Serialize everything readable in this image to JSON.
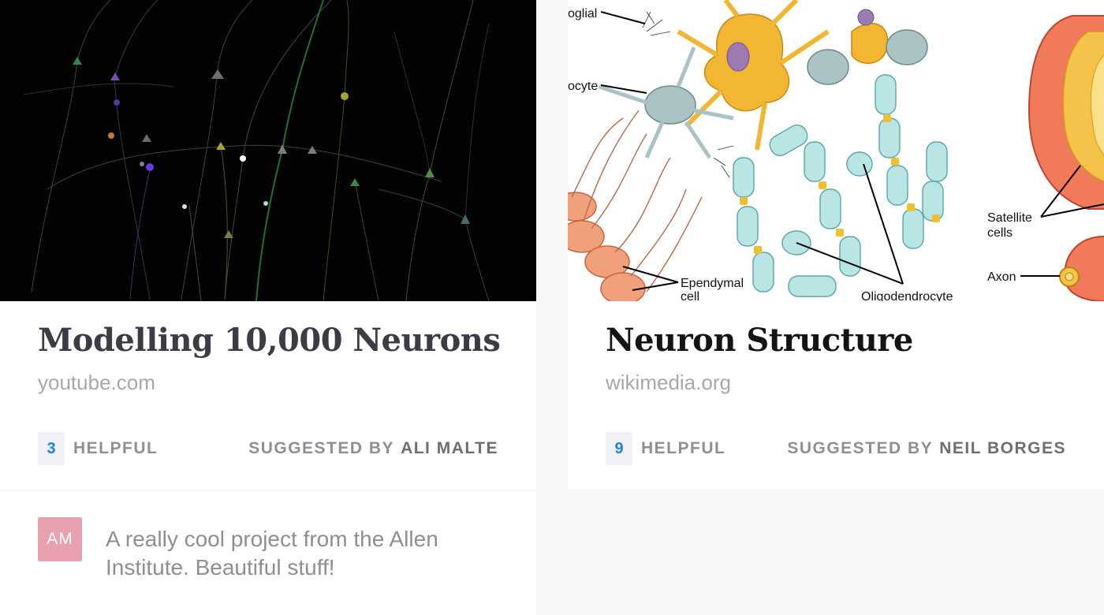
{
  "cards": [
    {
      "title": "Modelling 10,000 Neurons",
      "domain": "youtube.com",
      "helpful_count": "3",
      "helpful_label": "HELPFUL",
      "suggested_label": "SUGGESTED BY",
      "author": "ALI MALTE",
      "image": "neuron-simulation-render"
    },
    {
      "title": "Neuron Structure",
      "domain": "wikimedia.org",
      "helpful_count": "9",
      "helpful_label": "HELPFUL",
      "suggested_label": "SUGGESTED BY",
      "author": "NEIL BORGES",
      "image": "neuroglia-diagram",
      "diagram_labels": {
        "microglial": "oglial",
        "astrocyte": "ocyte",
        "ependymal_1": "Ependymal",
        "ependymal_2": "cell",
        "oligodendrocyte": "Oligodendrocyte",
        "satellite_1": "Satellite",
        "satellite_2": "cells",
        "axon": "Axon"
      }
    }
  ],
  "comment": {
    "avatar_initials": "AM",
    "text": "A really cool project from the Allen Institute. Beautiful stuff!"
  },
  "colors": {
    "accent": "#1b82e6",
    "avatar": "#e8a1b0",
    "background": "#f8f8f9"
  }
}
